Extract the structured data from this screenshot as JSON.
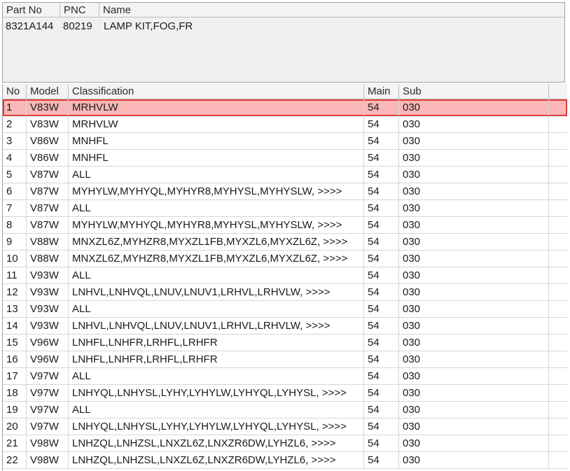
{
  "part_header": {
    "columns": [
      "Part No",
      "PNC",
      "Name"
    ],
    "values": [
      "8321A144",
      "80219",
      "LAMP KIT,FOG,FR"
    ]
  },
  "grid": {
    "columns": [
      "No",
      "Model",
      "Classification",
      "Main",
      "Sub"
    ],
    "selected_color": "#e13a3a",
    "rows": [
      {
        "no": "1",
        "model": "V83W",
        "classification": "MRHVLW",
        "main": "54",
        "sub": "030",
        "selected": true
      },
      {
        "no": "2",
        "model": "V83W",
        "classification": "MRHVLW",
        "main": "54",
        "sub": "030"
      },
      {
        "no": "3",
        "model": "V86W",
        "classification": "MNHFL",
        "main": "54",
        "sub": "030"
      },
      {
        "no": "4",
        "model": "V86W",
        "classification": "MNHFL",
        "main": "54",
        "sub": "030"
      },
      {
        "no": "5",
        "model": "V87W",
        "classification": "ALL",
        "main": "54",
        "sub": "030"
      },
      {
        "no": "6",
        "model": "V87W",
        "classification": "MYHYLW,MYHYQL,MYHYR8,MYHYSL,MYHYSLW,  >>>>",
        "main": "54",
        "sub": "030"
      },
      {
        "no": "7",
        "model": "V87W",
        "classification": "ALL",
        "main": "54",
        "sub": "030"
      },
      {
        "no": "8",
        "model": "V87W",
        "classification": "MYHYLW,MYHYQL,MYHYR8,MYHYSL,MYHYSLW,  >>>>",
        "main": "54",
        "sub": "030"
      },
      {
        "no": "9",
        "model": "V88W",
        "classification": "MNXZL6Z,MYHZR8,MYXZL1FB,MYXZL6,MYXZL6Z,  >>>>",
        "main": "54",
        "sub": "030"
      },
      {
        "no": "10",
        "model": "V88W",
        "classification": "MNXZL6Z,MYHZR8,MYXZL1FB,MYXZL6,MYXZL6Z,  >>>>",
        "main": "54",
        "sub": "030"
      },
      {
        "no": "11",
        "model": "V93W",
        "classification": "ALL",
        "main": "54",
        "sub": "030"
      },
      {
        "no": "12",
        "model": "V93W",
        "classification": "LNHVL,LNHVQL,LNUV,LNUV1,LRHVL,LRHVLW,  >>>>",
        "main": "54",
        "sub": "030"
      },
      {
        "no": "13",
        "model": "V93W",
        "classification": "ALL",
        "main": "54",
        "sub": "030"
      },
      {
        "no": "14",
        "model": "V93W",
        "classification": "LNHVL,LNHVQL,LNUV,LNUV1,LRHVL,LRHVLW,  >>>>",
        "main": "54",
        "sub": "030"
      },
      {
        "no": "15",
        "model": "V96W",
        "classification": "LNHFL,LNHFR,LRHFL,LRHFR",
        "main": "54",
        "sub": "030"
      },
      {
        "no": "16",
        "model": "V96W",
        "classification": "LNHFL,LNHFR,LRHFL,LRHFR",
        "main": "54",
        "sub": "030"
      },
      {
        "no": "17",
        "model": "V97W",
        "classification": "ALL",
        "main": "54",
        "sub": "030"
      },
      {
        "no": "18",
        "model": "V97W",
        "classification": "LNHYQL,LNHYSL,LYHY,LYHYLW,LYHYQL,LYHYSL,  >>>>",
        "main": "54",
        "sub": "030"
      },
      {
        "no": "19",
        "model": "V97W",
        "classification": "ALL",
        "main": "54",
        "sub": "030"
      },
      {
        "no": "20",
        "model": "V97W",
        "classification": "LNHYQL,LNHYSL,LYHY,LYHYLW,LYHYQL,LYHYSL,  >>>>",
        "main": "54",
        "sub": "030"
      },
      {
        "no": "21",
        "model": "V98W",
        "classification": "LNHZQL,LNHZSL,LNXZL6Z,LNXZR6DW,LYHZL6,  >>>>",
        "main": "54",
        "sub": "030"
      },
      {
        "no": "22",
        "model": "V98W",
        "classification": "LNHZQL,LNHZSL,LNXZL6Z,LNXZR6DW,LYHZL6,  >>>>",
        "main": "54",
        "sub": "030"
      }
    ]
  }
}
